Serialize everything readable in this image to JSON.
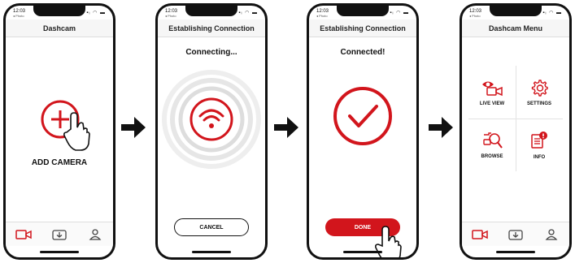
{
  "status": {
    "time": "12:03",
    "back_label": "◂ Photo",
    "icons": "▪ᵢ ◠ ▬"
  },
  "screens": [
    {
      "nav_title": "Dashcam",
      "add_label": "ADD CAMERA"
    },
    {
      "nav_title": "Establishing Connection",
      "heading": "Connecting...",
      "cancel_label": "CANCEL"
    },
    {
      "nav_title": "Establishing Connection",
      "heading": "Connected!",
      "done_label": "DONE"
    },
    {
      "nav_title": "Dashcam Menu",
      "menu": [
        {
          "label": "LIVE VIEW",
          "icon": "camera-eye-icon"
        },
        {
          "label": "SETTINGS",
          "icon": "gear-icon"
        },
        {
          "label": "BROWSE",
          "icon": "browse-search-icon"
        },
        {
          "label": "INFO",
          "icon": "info-document-icon"
        }
      ]
    }
  ],
  "tabbar": {
    "icons": [
      "camera-tab-icon",
      "download-tab-icon",
      "user-tab-icon"
    ]
  },
  "colors": {
    "accent": "#d2151c",
    "arrow": "#111111"
  }
}
